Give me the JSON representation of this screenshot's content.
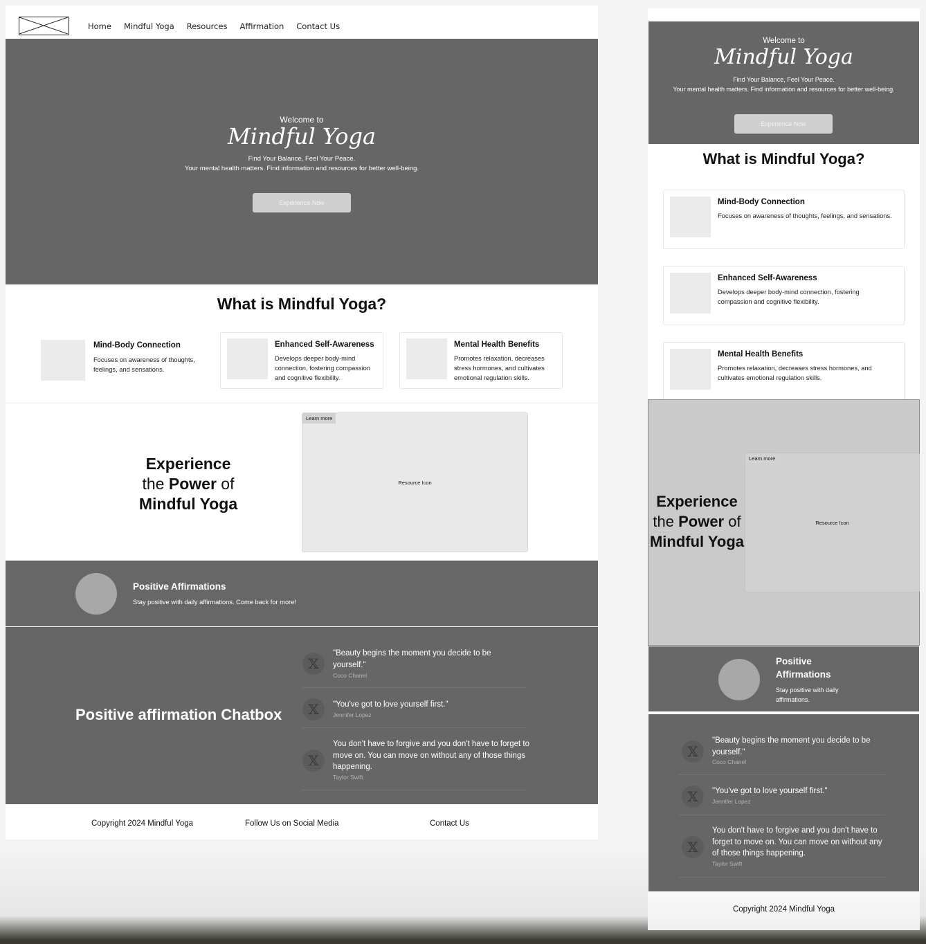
{
  "nav": {
    "links": [
      "Home",
      "Mindful Yoga",
      "Resources",
      "Affirmation",
      "Contact Us"
    ]
  },
  "hero": {
    "welcome": "Welcome to",
    "title": "Mindful Yoga",
    "subtitle1": "Find Your Balance, Feel Your Peace.",
    "subtitle2": "Your mental health matters. Find information and resources for better well-being.",
    "button": "Experience Now"
  },
  "what": {
    "title": "What is Mindful Yoga?",
    "cards": [
      {
        "title": "Mind-Body Connection",
        "desc_desktop": "Focuses on awareness of thoughts, feelings, and sensations.",
        "desc_mobile": "Focuses on awareness of thoughts, feelings, and sensations."
      },
      {
        "title": "Enhanced Self-Awareness",
        "desc_desktop": "Develops deeper body-mind connection, fostering compassion and cognitive flexibility.",
        "desc_mobile": "Develops deeper body-mind connection, fostering compassion and cognitive flexibility."
      },
      {
        "title": "Mental  Health Benefits",
        "desc_desktop": "Promotes relaxation, decreases stress hormones, and cultivates emotional regulation skills.",
        "desc_mobile": "Promotes relaxation, decreases stress hormones, and cultivates emotional regulation skills."
      }
    ]
  },
  "experience": {
    "line1": "Experience",
    "line2_a": "the ",
    "line2_b": "Power",
    "line2_c": " of",
    "line3": "Mindful Yoga",
    "learn_more": "Learn more",
    "resource_icon": "Resource Icon"
  },
  "affirmations": {
    "title": "Positive Affirmations",
    "desc_desktop": "Stay positive with daily affirmations. Come back for more!",
    "desc_mobile": "Stay positive with daily affirmations."
  },
  "chatbox": {
    "title": "Positive affirmation Chatbox",
    "icon": "x-icon",
    "icon_glyph": "𝕏",
    "quotes": [
      {
        "text": "\"Beauty begins the moment you decide to be yourself.\"",
        "author": "Coco Chanel"
      },
      {
        "text": "\"You've got to love yourself first.\"",
        "author": "Jennifer Lopez"
      },
      {
        "text": "You don't have to forgive and you don't have to forget to move on. You can move on without any of those things happening.",
        "author": "Taylor Swift"
      }
    ]
  },
  "footer": {
    "copyright": "Copyright 2024 Mindful Yoga",
    "social": "Follow Us on Social Media",
    "contact": "Contact Us"
  },
  "colors": {
    "hero_bg": "#666666",
    "card_placeholder": "#ebebeb",
    "button_bg": "#cfcfcf",
    "avatar": "#a8a8a8"
  }
}
